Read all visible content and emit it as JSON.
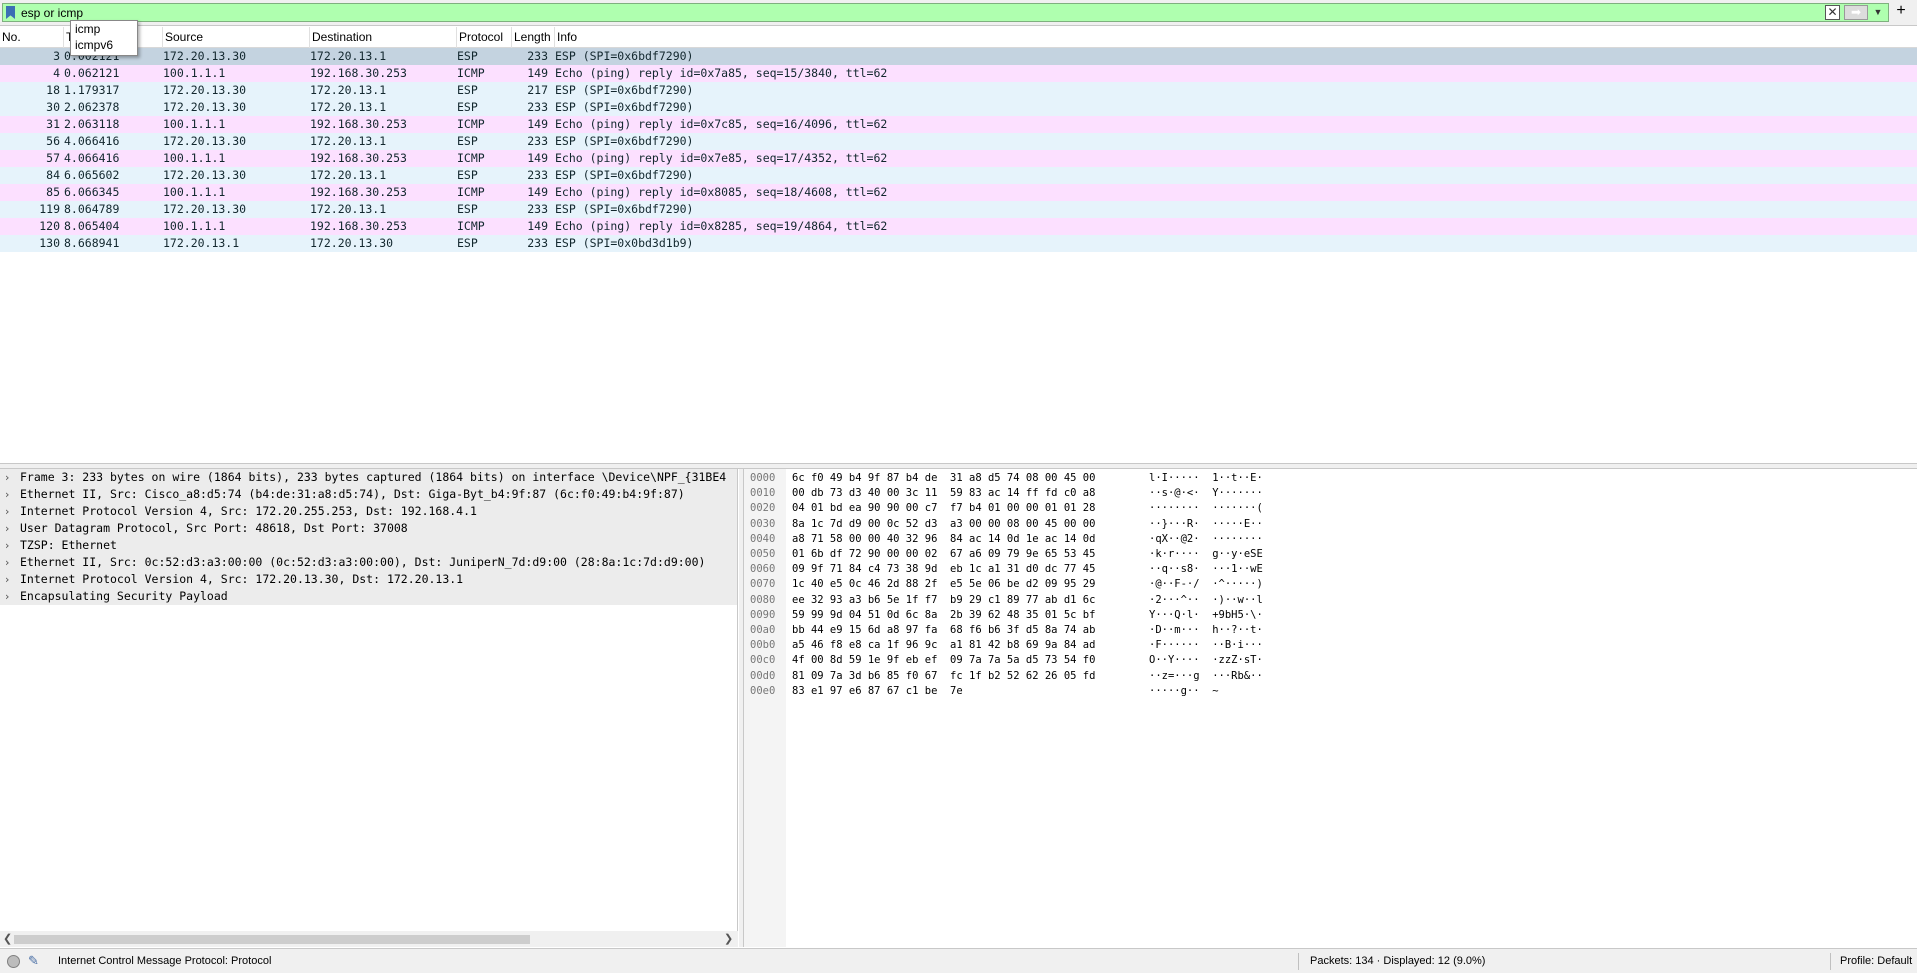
{
  "filter": {
    "value": "esp or icmp",
    "autocomplete": [
      "icmp",
      "icmpv6"
    ]
  },
  "packet_list": {
    "columns": [
      "No.",
      "Time",
      "Source",
      "Destination",
      "Protocol",
      "Length",
      "Info"
    ],
    "rows": [
      {
        "no": "3",
        "time": "0.002121",
        "src": "172.20.13.30",
        "dst": "172.20.13.1",
        "proto": "ESP",
        "len": "233",
        "info": "ESP (SPI=0x6bdf7290)",
        "type": "esp",
        "selected": true
      },
      {
        "no": "4",
        "time": "0.062121",
        "src": "100.1.1.1",
        "dst": "192.168.30.253",
        "proto": "ICMP",
        "len": "149",
        "info": "Echo (ping) reply    id=0x7a85, seq=15/3840, ttl=62",
        "type": "icmp"
      },
      {
        "no": "18",
        "time": "1.179317",
        "src": "172.20.13.30",
        "dst": "172.20.13.1",
        "proto": "ESP",
        "len": "217",
        "info": "ESP (SPI=0x6bdf7290)",
        "type": "esp"
      },
      {
        "no": "30",
        "time": "2.062378",
        "src": "172.20.13.30",
        "dst": "172.20.13.1",
        "proto": "ESP",
        "len": "233",
        "info": "ESP (SPI=0x6bdf7290)",
        "type": "esp"
      },
      {
        "no": "31",
        "time": "2.063118",
        "src": "100.1.1.1",
        "dst": "192.168.30.253",
        "proto": "ICMP",
        "len": "149",
        "info": "Echo (ping) reply    id=0x7c85, seq=16/4096, ttl=62",
        "type": "icmp"
      },
      {
        "no": "56",
        "time": "4.066416",
        "src": "172.20.13.30",
        "dst": "172.20.13.1",
        "proto": "ESP",
        "len": "233",
        "info": "ESP (SPI=0x6bdf7290)",
        "type": "esp"
      },
      {
        "no": "57",
        "time": "4.066416",
        "src": "100.1.1.1",
        "dst": "192.168.30.253",
        "proto": "ICMP",
        "len": "149",
        "info": "Echo (ping) reply    id=0x7e85, seq=17/4352, ttl=62",
        "type": "icmp"
      },
      {
        "no": "84",
        "time": "6.065602",
        "src": "172.20.13.30",
        "dst": "172.20.13.1",
        "proto": "ESP",
        "len": "233",
        "info": "ESP (SPI=0x6bdf7290)",
        "type": "esp"
      },
      {
        "no": "85",
        "time": "6.066345",
        "src": "100.1.1.1",
        "dst": "192.168.30.253",
        "proto": "ICMP",
        "len": "149",
        "info": "Echo (ping) reply    id=0x8085, seq=18/4608, ttl=62",
        "type": "icmp"
      },
      {
        "no": "119",
        "time": "8.064789",
        "src": "172.20.13.30",
        "dst": "172.20.13.1",
        "proto": "ESP",
        "len": "233",
        "info": "ESP (SPI=0x6bdf7290)",
        "type": "esp"
      },
      {
        "no": "120",
        "time": "8.065404",
        "src": "100.1.1.1",
        "dst": "192.168.30.253",
        "proto": "ICMP",
        "len": "149",
        "info": "Echo (ping) reply    id=0x8285, seq=19/4864, ttl=62",
        "type": "icmp"
      },
      {
        "no": "130",
        "time": "8.668941",
        "src": "172.20.13.1",
        "dst": "172.20.13.30",
        "proto": "ESP",
        "len": "233",
        "info": "ESP (SPI=0x0bd3d1b9)",
        "type": "esp"
      }
    ]
  },
  "details": [
    {
      "text": "Frame 3: 233 bytes on wire (1864 bits), 233 bytes captured (1864 bits) on interface \\Device\\NPF_{31BE4",
      "selected": true
    },
    {
      "text": "Ethernet II, Src: Cisco_a8:d5:74 (b4:de:31:a8:d5:74), Dst: Giga-Byt_b4:9f:87 (6c:f0:49:b4:9f:87)",
      "selected": true
    },
    {
      "text": "Internet Protocol Version 4, Src: 172.20.255.253, Dst: 192.168.4.1",
      "selected": true
    },
    {
      "text": "User Datagram Protocol, Src Port: 48618, Dst Port: 37008",
      "selected": true
    },
    {
      "text": "TZSP: Ethernet",
      "selected": true
    },
    {
      "text": "Ethernet II, Src: 0c:52:d3:a3:00:00 (0c:52:d3:a3:00:00), Dst: JuniperN_7d:d9:00 (28:8a:1c:7d:d9:00)",
      "selected": true
    },
    {
      "text": "Internet Protocol Version 4, Src: 172.20.13.30, Dst: 172.20.13.1",
      "selected": true
    },
    {
      "text": "Encapsulating Security Payload",
      "selected": true
    }
  ],
  "bytes": [
    {
      "off": "0000",
      "hex": "6c f0 49 b4 9f 87 b4 de  31 a8 d5 74 08 00 45 00",
      "asc": "l·I·····  1··t··E·"
    },
    {
      "off": "0010",
      "hex": "00 db 73 d3 40 00 3c 11  59 83 ac 14 ff fd c0 a8",
      "asc": "··s·@·<·  Y·······"
    },
    {
      "off": "0020",
      "hex": "04 01 bd ea 90 90 00 c7  f7 b4 01 00 00 01 01 28",
      "asc": "········  ·······("
    },
    {
      "off": "0030",
      "hex": "8a 1c 7d d9 00 0c 52 d3  a3 00 00 08 00 45 00 00",
      "asc": "··}···R·  ·····E··"
    },
    {
      "off": "0040",
      "hex": "a8 71 58 00 00 40 32 96  84 ac 14 0d 1e ac 14 0d",
      "asc": "·qX··@2·  ········"
    },
    {
      "off": "0050",
      "hex": "01 6b df 72 90 00 00 02  67 a6 09 79 9e 65 53 45",
      "asc": "·k·r····  g··y·eSE"
    },
    {
      "off": "0060",
      "hex": "09 9f 71 84 c4 73 38 9d  eb 1c a1 31 d0 dc 77 45",
      "asc": "··q··s8·  ···1··wE"
    },
    {
      "off": "0070",
      "hex": "1c 40 e5 0c 46 2d 88 2f  e5 5e 06 be d2 09 95 29",
      "asc": "·@··F-·/  ·^·····)"
    },
    {
      "off": "0080",
      "hex": "ee 32 93 a3 b6 5e 1f f7  b9 29 c1 89 77 ab d1 6c",
      "asc": "·2···^··  ·)··w··l"
    },
    {
      "off": "0090",
      "hex": "59 99 9d 04 51 0d 6c 8a  2b 39 62 48 35 01 5c bf",
      "asc": "Y···Q·l·  +9bH5·\\·"
    },
    {
      "off": "00a0",
      "hex": "bb 44 e9 15 6d a8 97 fa  68 f6 b6 3f d5 8a 74 ab",
      "asc": "·D··m···  h··?··t·"
    },
    {
      "off": "00b0",
      "hex": "a5 46 f8 e8 ca 1f 96 9c  a1 81 42 b8 69 9a 84 ad",
      "asc": "·F······  ··B·i···"
    },
    {
      "off": "00c0",
      "hex": "4f 00 8d 59 1e 9f eb ef  09 7a 7a 5a d5 73 54 f0",
      "asc": "O··Y····  ·zzZ·sT·"
    },
    {
      "off": "00d0",
      "hex": "81 09 7a 3d b6 85 f0 67  fc 1f b2 52 62 26 05 fd",
      "asc": "··z=···g  ···Rb&··"
    },
    {
      "off": "00e0",
      "hex": "83 e1 97 e6 87 67 c1 be  7e",
      "asc": "·····g··  ~"
    }
  ],
  "status": {
    "field": "Internet Control Message Protocol: Protocol",
    "packets": "Packets: 134 · Displayed: 12 (9.0%)",
    "profile": "Profile: Default"
  },
  "colors": {
    "filter_valid": "#afffaf",
    "esp_row": "#e6f3fb",
    "icmp_row": "#fce0ff",
    "selected_row": "#c4d3e0"
  }
}
